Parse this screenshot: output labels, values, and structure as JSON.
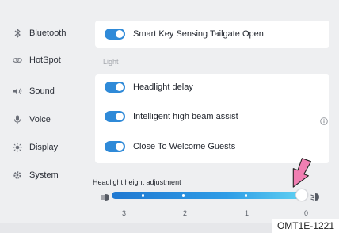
{
  "sidebar": {
    "items": [
      {
        "label": "Bluetooth",
        "icon": "bluetooth-icon"
      },
      {
        "label": "HotSpot",
        "icon": "hotspot-icon"
      },
      {
        "label": "Sound",
        "icon": "sound-icon"
      },
      {
        "label": "Voice",
        "icon": "voice-icon"
      },
      {
        "label": "Display",
        "icon": "display-icon"
      },
      {
        "label": "System",
        "icon": "system-icon"
      }
    ]
  },
  "settings": {
    "top_toggle": {
      "label": "Smart Key Sensing Tailgate Open",
      "on": true
    },
    "section_label": "Light",
    "light_toggles": [
      {
        "label": "Headlight delay",
        "on": true
      },
      {
        "label": "Intelligent high beam assist",
        "on": true
      },
      {
        "label": "Close To Welcome Guests",
        "on": true
      }
    ],
    "slider": {
      "title": "Headlight height adjustment",
      "ticks": [
        "3",
        "2",
        "1",
        "0"
      ],
      "value": 0
    }
  },
  "caption": "OMT1E-1221",
  "colors": {
    "accent": "#2f8ad8",
    "annotation_arrow": "#f07fb2"
  }
}
